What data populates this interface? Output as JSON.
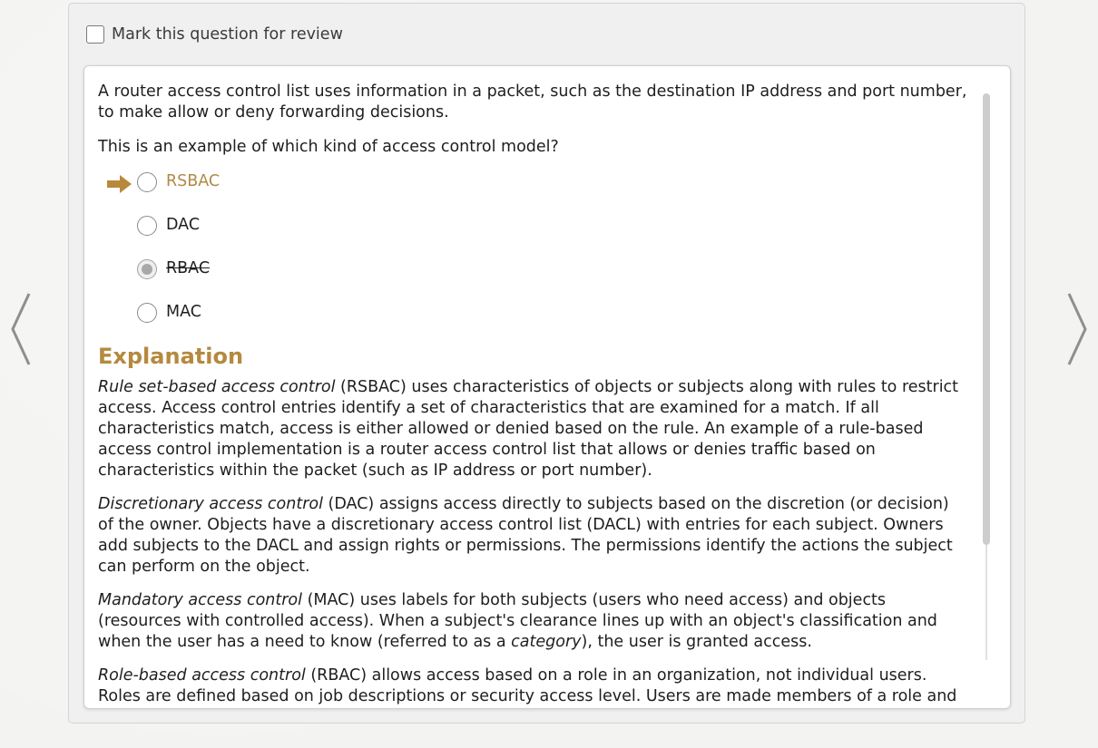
{
  "review": {
    "label": "Mark this question for review",
    "checked": false
  },
  "question": {
    "text": "A router access control list uses information in a packet, such as the destination IP address and port number, to make allow or deny forwarding decisions.",
    "prompt": "This is an example of which kind of access control model?",
    "options": [
      {
        "label": "RSBAC",
        "state": "correct-answer",
        "indicator": "arrow-right-icon"
      },
      {
        "label": "DAC",
        "state": "unselected"
      },
      {
        "label": "RBAC",
        "state": "selected-incorrect"
      },
      {
        "label": "MAC",
        "state": "unselected"
      }
    ]
  },
  "explanation": {
    "heading": "Explanation",
    "paragraphs": [
      {
        "term": "Rule set-based access control",
        "text": " (RSBAC) uses characteristics of objects or subjects along with rules to restrict access. Access control entries identify a set of characteristics that are examined for a match. If all characteristics match, access is either allowed or denied based on the rule. An example of a rule-based access control implementation is a router access control list that allows or denies traffic based on characteristics within the packet (such as IP address or port number)."
      },
      {
        "term": "Discretionary access control",
        "text": " (DAC) assigns access directly to subjects based on the discretion (or decision) of the owner. Objects have a discretionary access control list (DACL) with entries for each subject. Owners add subjects to the DACL and assign rights or permissions. The permissions identify the actions the subject can perform on the object."
      },
      {
        "term": "Mandatory access control",
        "text_before": " (MAC) uses labels for both subjects (users who need access) and objects (resources with controlled access). When a subject's clearance lines up with an object's classification and when the user has a need to know (referred to as a ",
        "em": "category",
        "text_after": "), the user is granted access."
      },
      {
        "term": "Role-based access control",
        "text": " (RBAC) allows access based on a role in an organization, not individual users. Roles are defined based on job descriptions or security access level. Users are made members of a role and receive"
      }
    ]
  },
  "navigation": {
    "prev_icon": "chevron-left-icon",
    "next_icon": "chevron-right-icon"
  },
  "colors": {
    "accent": "#b5893e",
    "correct_answer": "#b08a45",
    "arrow": "#b8893a"
  }
}
